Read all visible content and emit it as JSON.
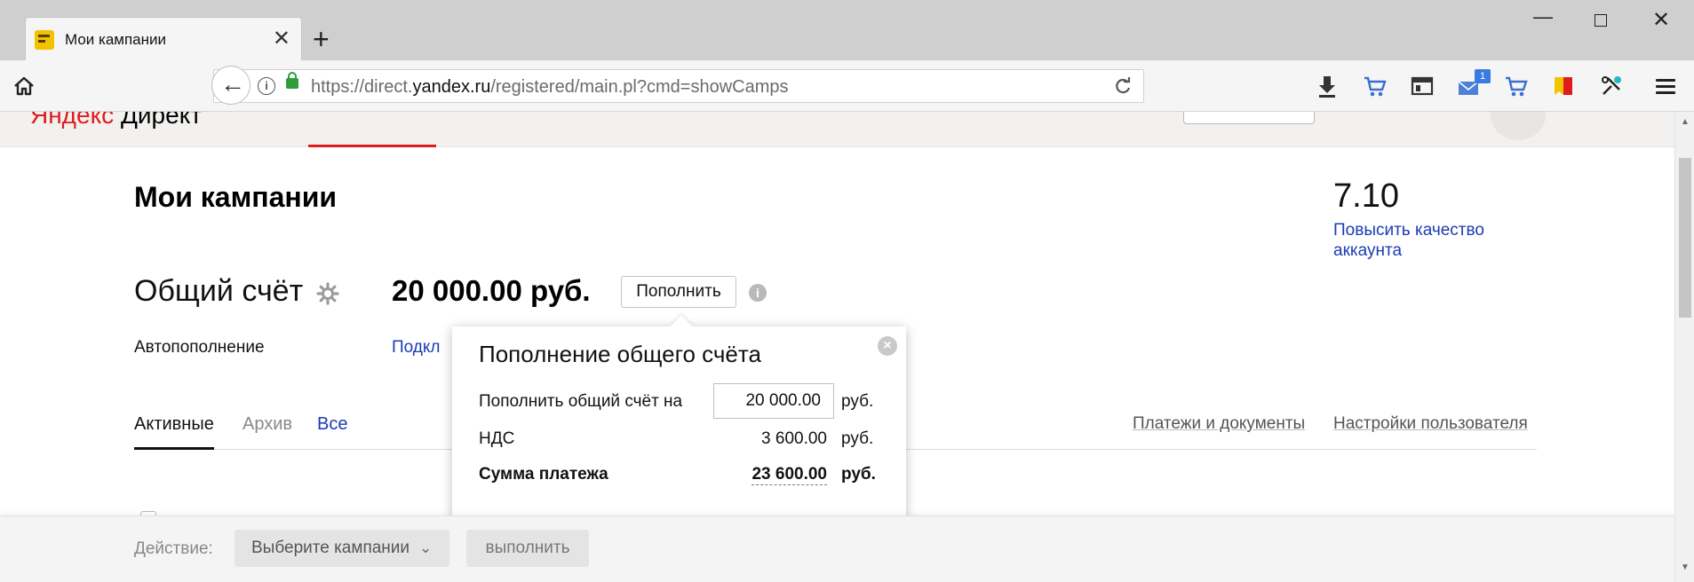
{
  "browser": {
    "tab_title": "Мои кампании",
    "new_tab_symbol": "+",
    "close_symbol": "✕",
    "url_prefix": "https://direct.",
    "url_domain": "yandex.ru",
    "url_path": "/registered/main.pl?cmd=showCamps",
    "win_minimize": "—",
    "win_close": "✕",
    "downloads_badge": "1",
    "icons": [
      "home-icon",
      "back-icon",
      "info-icon",
      "lock-icon",
      "reload-icon",
      "download-icon",
      "cart-icon",
      "window-icon",
      "mail-icon",
      "cart-icon",
      "bookmark-icon",
      "tools-icon",
      "menu-icon"
    ]
  },
  "site": {
    "logo_ya": "Яндекс",
    "logo_rest": " Директ"
  },
  "page": {
    "title": "Мои кампании",
    "score": "7.10",
    "quality_link": "Повысить качество аккаунта",
    "account_title": "Общий счёт",
    "account_sum": "20 000.00 руб.",
    "topup_button": "Пополнить",
    "autotopup_label": "Автопополнение",
    "autotopup_link": "Подкл"
  },
  "tabs": {
    "active": "Активные",
    "archive": "Архив",
    "all": "Все",
    "payments_link": "Платежи и документы",
    "settings_link": "Настройки пользователя"
  },
  "popup": {
    "title": "Пополнение общего счёта",
    "amount_label": "Пополнить общий счёт на",
    "amount_value": "20 000.00",
    "unit": "руб.",
    "vat_label": "НДС",
    "vat_value": "3 600.00",
    "total_label": "Сумма платежа",
    "total_value": "23 600.00"
  },
  "actionbar": {
    "label": "Действие:",
    "select_placeholder": "Выберите кампании",
    "execute_button": "выполнить"
  },
  "colors": {
    "link": "#1a3cb3",
    "accent_red": "#e01b1b",
    "ssl_green": "#2e9d3a"
  }
}
